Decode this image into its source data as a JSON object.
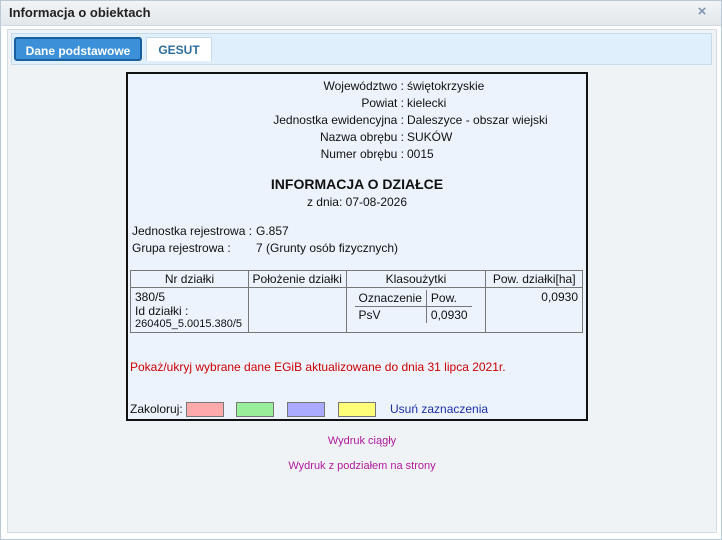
{
  "window": {
    "title": "Informacja o obiektach",
    "close_glyph": "×"
  },
  "tabs": [
    {
      "label": "Dane podstawowe"
    },
    {
      "label": "GESUT"
    }
  ],
  "info": [
    {
      "label": "Województwo :",
      "value": "świętokrzyskie"
    },
    {
      "label": "Powiat :",
      "value": "kielecki"
    },
    {
      "label": "Jednostka ewidencyjna :",
      "value": "Daleszyce - obszar wiejski"
    },
    {
      "label": "Nazwa obrębu :",
      "value": "SUKÓW"
    },
    {
      "label": "Numer obrębu :",
      "value": "0015"
    }
  ],
  "heading": "INFORMACJA O DZIAŁCE",
  "date_line": "z dnia: 07-08-2026",
  "registry": {
    "unit_label": "Jednostka rejestrowa :",
    "unit_value": "G.857",
    "group_label": "Grupa rejestrowa :",
    "group_value": "7 (Grunty osób fizycznych)"
  },
  "table": {
    "headers": [
      "Nr działki",
      "Położenie działki",
      "Klasoużytki",
      "Pow. działki[ha]"
    ],
    "row": {
      "nr": "380/5",
      "id_label": "Id działki :",
      "id_value": "260405_5.0015.380/5",
      "location": "",
      "class_headers": [
        "Oznaczenie",
        "Pow."
      ],
      "class_row": [
        "PsV",
        "0,0930"
      ],
      "area": "0,0930"
    }
  },
  "update_text": "Pokaż/ukryj wybrane dane EGiB aktualizowane do dnia 31 lipca 2021r.",
  "colorize": {
    "label": "Zakoloruj:",
    "colors": [
      "#ffaaaa",
      "#99ee99",
      "#aaaaff",
      "#ffff77"
    ],
    "clear_label": "Usuń zaznaczenia"
  },
  "print_links": [
    "Wydruk ciągły",
    "Wydruk z podziałem na strony"
  ],
  "accent_colors": {
    "tab_active": "#3b90d8",
    "update_text": "#cc0000",
    "link": "#b0199f",
    "clear_link": "#1e2fa8"
  }
}
